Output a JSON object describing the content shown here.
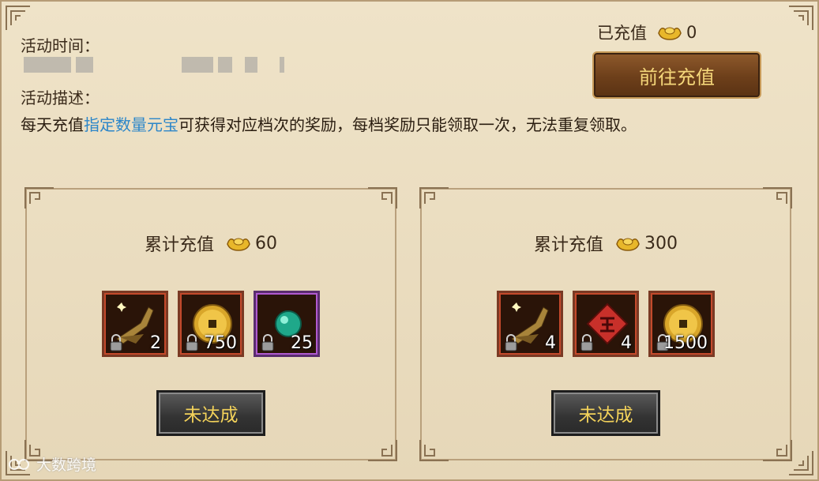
{
  "activity": {
    "time_label": "活动时间：",
    "desc_label": "活动描述：",
    "desc_prefix": "每天充值",
    "desc_highlight": "指定数量元宝",
    "desc_suffix": "可获得对应档次的奖励，每档奖励只能领取一次，无法重复领取。"
  },
  "recharge": {
    "label": "已充值",
    "amount": "0",
    "button": "前往充值"
  },
  "tiers": [
    {
      "label": "累计充值",
      "amount": "60",
      "button": "未达成",
      "items": [
        {
          "icon": "scroll-icon",
          "qty": "2"
        },
        {
          "icon": "gold-coin-icon",
          "qty": "750"
        },
        {
          "icon": "jade-orb-icon",
          "qty": "25"
        }
      ]
    },
    {
      "label": "累计充值",
      "amount": "300",
      "button": "未达成",
      "items": [
        {
          "icon": "scroll-icon",
          "qty": "4"
        },
        {
          "icon": "red-rune-icon",
          "qty": "4"
        },
        {
          "icon": "gold-coin-icon",
          "qty": "1500"
        }
      ]
    }
  ],
  "watermark": "大数跨境",
  "colors": {
    "highlight": "#2c86c9",
    "button_text": "#f5d77a"
  }
}
